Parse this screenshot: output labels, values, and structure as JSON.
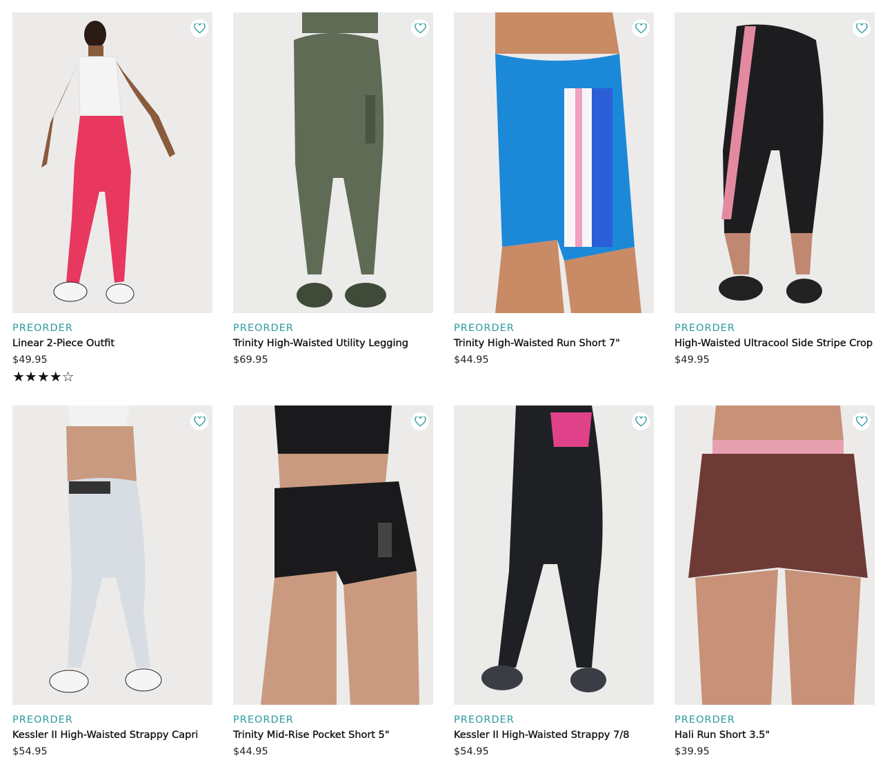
{
  "products": [
    {
      "badge": "PREORDER",
      "name": "Linear 2-Piece Outfit",
      "price": "$49.95",
      "rating": "★★★★☆",
      "image": "model in white tank and pink leggings",
      "colors": {
        "bottom": "#e8385f",
        "top": "#f4f4f4",
        "bg": "#ecebea"
      }
    },
    {
      "badge": "PREORDER",
      "name": "Trinity High-Waisted Utility Legging",
      "price": "$69.95",
      "image": "olive green leggings rear view",
      "colors": {
        "bottom": "#5f6b55",
        "top": "#6a7660",
        "bg": "#ebebea"
      }
    },
    {
      "badge": "PREORDER",
      "name": "Trinity High-Waisted Run Short 7\"",
      "price": "$44.95",
      "image": "blue bike shorts with pink stripe",
      "colors": {
        "bottom": "#1c88d8",
        "top": "#1c88d8",
        "bg": "#ecebea"
      }
    },
    {
      "badge": "PREORDER",
      "name": "High-Waisted Ultracool Side Stripe Crop",
      "price": "$49.95",
      "image": "black crop leggings with pink side stripe",
      "colors": {
        "bottom": "#1d1d1f",
        "top": "#1d1d1f",
        "bg": "#ebebea"
      }
    },
    {
      "badge": "PREORDER",
      "name": "Kessler II High-Waisted Strappy Capri",
      "price": "$54.95",
      "image": "light grey capri leggings",
      "colors": {
        "bottom": "#d8dde3",
        "top": "#f2f2f2",
        "bg": "#ecebea"
      }
    },
    {
      "badge": "PREORDER",
      "name": "Trinity Mid-Rise Pocket Short 5\"",
      "price": "$44.95",
      "image": "black pocket shorts",
      "colors": {
        "bottom": "#1a1a1c",
        "top": "#1a1a1c",
        "bg": "#ecebea"
      }
    },
    {
      "badge": "PREORDER",
      "name": "Kessler II High-Waisted Strappy 7/8",
      "price": "$54.95",
      "image": "black leggings with pink back straps",
      "colors": {
        "bottom": "#1e2024",
        "top": "#1e2024",
        "bg": "#ebebea"
      }
    },
    {
      "badge": "PREORDER",
      "name": "Hali Run Short 3.5\"",
      "price": "$39.95",
      "image": "maroon running shorts",
      "colors": {
        "bottom": "#6e3a36",
        "top": "#6e3a36",
        "bg": "#ecebea"
      }
    }
  ],
  "icons": {
    "favorite": "heart-outline-icon"
  },
  "accent": "#2a9a9e"
}
